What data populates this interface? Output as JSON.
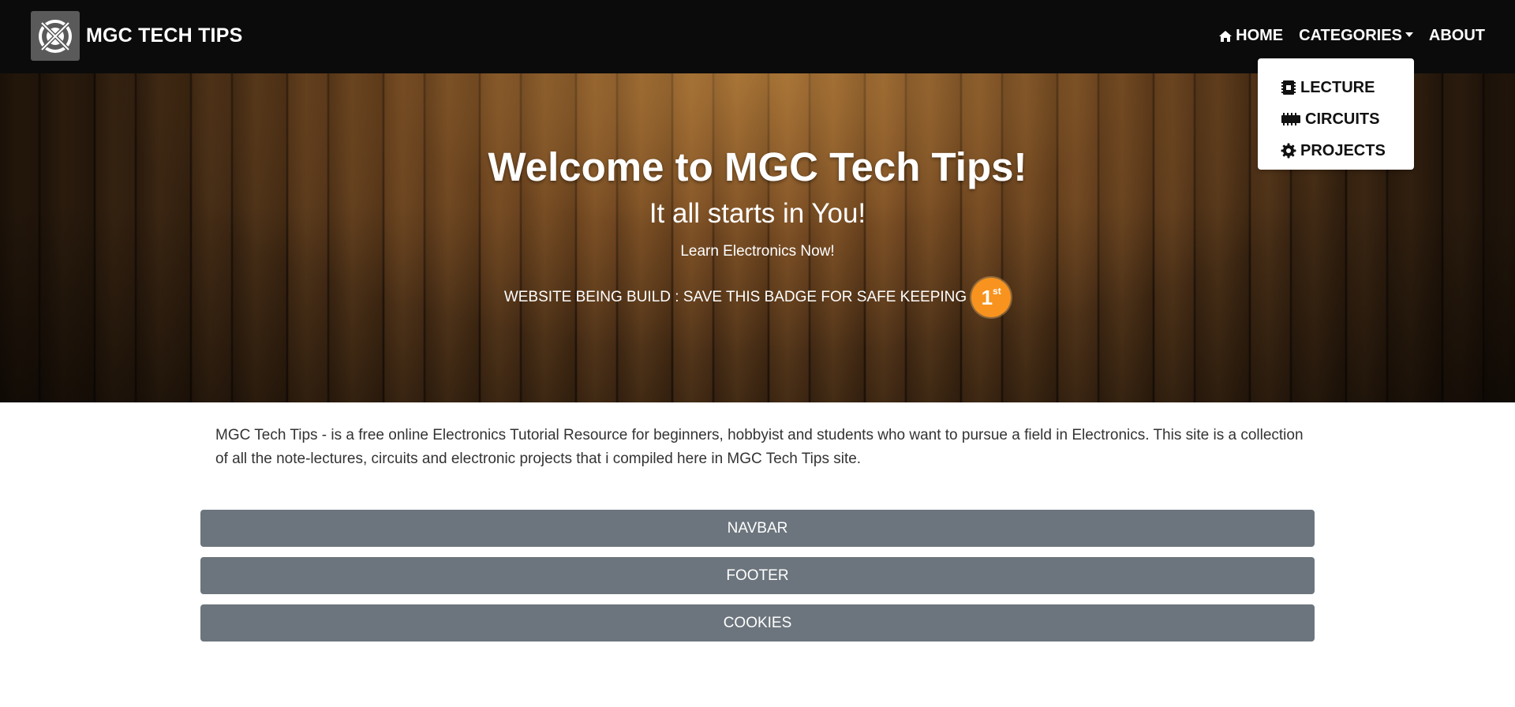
{
  "navbar": {
    "brand": "MGC TECH TIPS",
    "links": {
      "home": "HOME",
      "categories": "CATEGORIES",
      "about": "ABOUT"
    }
  },
  "dropdown": {
    "items": [
      {
        "label": "LECTURE",
        "icon": "chip-icon"
      },
      {
        "label": "CIRCUITS",
        "icon": "memory-icon"
      },
      {
        "label": "PROJECTS",
        "icon": "gear-icon"
      }
    ]
  },
  "hero": {
    "title": "Welcome to MGC Tech Tips!",
    "subtitle": "It all starts in You!",
    "tagline": "Learn Electronics Now!",
    "notice": "WEBSITE BEING BUILD : SAVE THIS BADGE FOR SAFE KEEPING",
    "badge_number": "1",
    "badge_suffix": "st"
  },
  "intro": {
    "text": "MGC Tech Tips - is a free online Electronics Tutorial Resource for beginners, hobbyist and students who want to pursue a field in Electronics. This site is a collection of all the note-lectures, circuits and electronic projects that i compiled here in MGC Tech Tips site."
  },
  "buttons": {
    "navbar": "NAVBAR",
    "footer": "FOOTER",
    "cookies": "COOKIES"
  },
  "colors": {
    "navbar_bg": "#0b0b0b",
    "button_bg": "#6c757d",
    "badge": "#f7931e"
  }
}
